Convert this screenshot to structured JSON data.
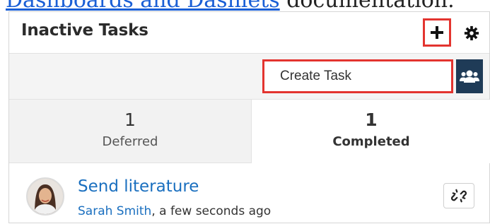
{
  "doc_text": {
    "link": "Dashboards and Dashlets",
    "rest": " documentation."
  },
  "dashlet": {
    "title": "Inactive Tasks",
    "add_icon": "plus-icon",
    "settings_icon": "gear-icon"
  },
  "toolbar": {
    "create_label": "Create Task",
    "team_icon": "users-icon"
  },
  "tabs": [
    {
      "count": "1",
      "label": "Deferred",
      "active": false
    },
    {
      "count": "1",
      "label": "Completed",
      "active": true
    }
  ],
  "task": {
    "name": "Send literature",
    "assigned_user": "Sarah Smith",
    "time_suffix": ", a few seconds ago",
    "unlink_icon": "unlink-icon"
  },
  "colors": {
    "highlight": "#e3342f",
    "link": "#1a6fbf",
    "team_button": "#1f3b57"
  }
}
